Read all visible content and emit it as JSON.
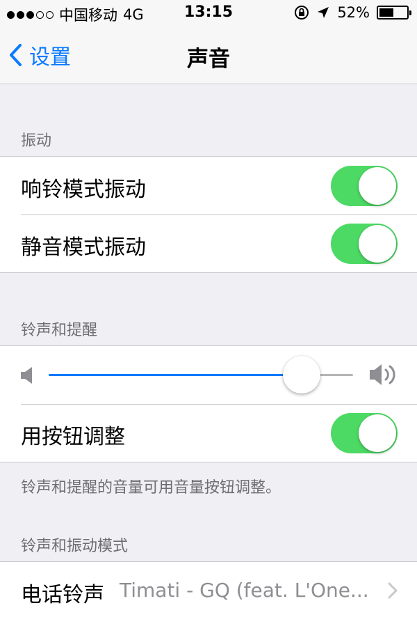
{
  "status_bar": {
    "carrier": "中国移动",
    "network": "4G",
    "time": "13:15",
    "battery_percent": "52%",
    "battery_level": 0.52,
    "signal_strength": 3,
    "signal_max": 5
  },
  "nav": {
    "back_label": "设置",
    "title": "声音"
  },
  "sections": {
    "vibrate": {
      "header": "振动",
      "rows": [
        {
          "label": "响铃模式振动",
          "on": true
        },
        {
          "label": "静音模式振动",
          "on": true
        }
      ]
    },
    "ringer_alerts": {
      "header": "铃声和提醒",
      "volume_level": 0.83,
      "change_with_buttons": {
        "label": "用按钮调整",
        "on": true
      },
      "footer": "铃声和提醒的音量可用音量按钮调整。"
    },
    "patterns": {
      "header": "铃声和振动模式",
      "ringtone": {
        "label": "电话铃声",
        "value": "Timati - GQ (feat. L'One..."
      }
    }
  },
  "colors": {
    "accent": "#0a7aff",
    "toggle_on": "#4cd964",
    "background": "#efeff4",
    "secondary_text": "#6d6d72"
  }
}
